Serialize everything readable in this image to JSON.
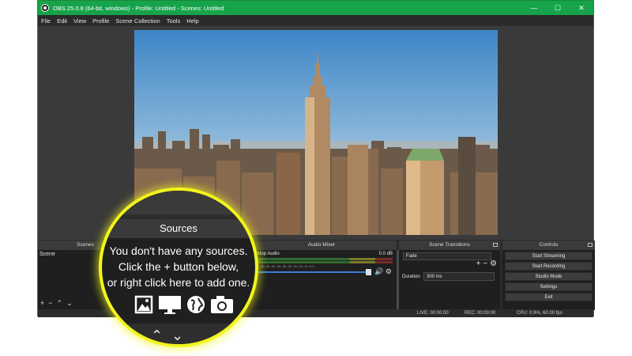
{
  "window": {
    "title": "OBS 25.0.8 (64-bit, windows) - Profile: Untitled - Scenes: Untitled",
    "controls": {
      "minimize": "—",
      "maximize": "☐",
      "close": "✕"
    }
  },
  "menu": [
    "File",
    "Edit",
    "View",
    "Profile",
    "Scene Collection",
    "Tools",
    "Help"
  ],
  "scenes": {
    "title": "Scenes",
    "items": [
      "Scene"
    ],
    "tools": {
      "add": "+",
      "remove": "−",
      "up": "⌃",
      "down": "⌄"
    }
  },
  "mixer": {
    "title": "Audio Mixer",
    "source": "Desktop Audio",
    "level": "0.0 dB",
    "ticks": "-60 -55 -50 -45 -40 -35 -30 -25 -20 -15 -10 -5 0"
  },
  "transitions": {
    "title": "Scene Transitions",
    "selected": "Fade",
    "duration_label": "Duration",
    "duration": "300 ms",
    "add": "+",
    "remove": "−"
  },
  "controls": {
    "title": "Controls",
    "buttons": [
      "Start Streaming",
      "Start Recording",
      "Studio Mode",
      "Settings",
      "Exit"
    ]
  },
  "status": {
    "live": "LIVE: 00:00:00",
    "rec": "REC: 00:00:00",
    "cpu": "CPU: 0.9%, 60.00 fps"
  },
  "magnifier": {
    "title": "Sources",
    "message": [
      "You don't have any sources.",
      "Click the + button below,",
      "or right click here to add one."
    ],
    "icons": [
      "image-icon",
      "display-capture-icon",
      "browser-globe-icon",
      "camera-icon"
    ],
    "accent": "#f2f51a"
  }
}
